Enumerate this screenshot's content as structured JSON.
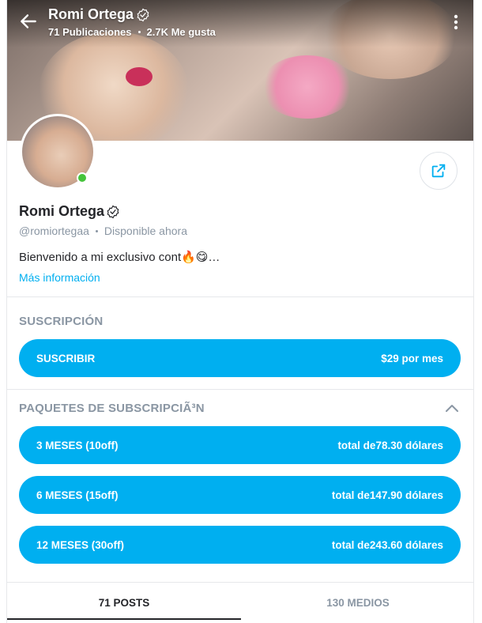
{
  "header": {
    "name": "Romi Ortega",
    "posts_count": "71 Publicaciones",
    "likes_count": "2.7K Me gusta"
  },
  "profile": {
    "name": "Romi Ortega",
    "handle": "@romiortegaa",
    "availability": "Disponible ahora",
    "bio": "Bienvenido a mi exclusivo cont🔥😋…",
    "more_info": "Más información",
    "online_color": "#45c43b"
  },
  "subscription": {
    "section_title": "SUSCRIPCIÓN",
    "button_label": "SUSCRIBIR",
    "button_price": "$29 por mes"
  },
  "bundles": {
    "section_title": "PAQUETES DE SUBSCRIPCIÃ³N",
    "items": [
      {
        "label": "3 MESES (10off)",
        "price": "total de78.30 dólares"
      },
      {
        "label": "6 MESES (15off)",
        "price": "total de147.90 dólares"
      },
      {
        "label": "12 MESES (30off)",
        "price": "total de243.60 dólares"
      }
    ]
  },
  "tabs": [
    {
      "label": "71 POSTS",
      "active": true
    },
    {
      "label": "130 MEDIOS",
      "active": false
    }
  ],
  "colors": {
    "accent": "#00aff0",
    "text": "#242529",
    "muted": "#8a96a3"
  },
  "icons": {
    "back": "arrow-left-icon",
    "more": "more-vertical-icon",
    "verified": "verified-badge-icon",
    "share": "share-icon",
    "collapse": "chevron-up-icon"
  }
}
